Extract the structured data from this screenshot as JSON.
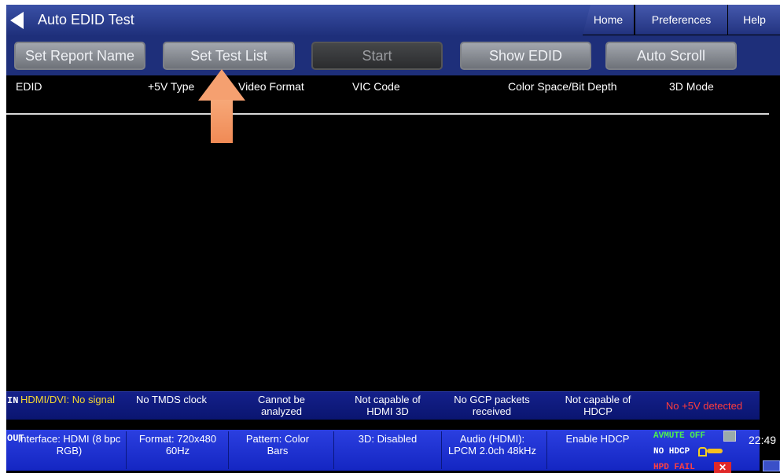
{
  "app": {
    "title": "Auto EDID Test"
  },
  "nav_tabs": {
    "home": "Home",
    "preferences": "Preferences",
    "help": "Help"
  },
  "toolbar": {
    "set_report_name": "Set Report Name",
    "set_test_list": "Set Test List",
    "start": "Start",
    "show_edid": "Show EDID",
    "auto_scroll": "Auto Scroll"
  },
  "table": {
    "columns": [
      "EDID",
      "+5V Type",
      "Video Format",
      "VIC Code",
      "Color Space/Bit Depth",
      "3D Mode"
    ],
    "rows": []
  },
  "status_in": {
    "side_label": "IN",
    "cells": [
      {
        "text": "HDMI/DVI: No signal",
        "color": "#f5d830"
      },
      {
        "text": "No TMDS clock",
        "color": "#ffffff"
      },
      {
        "text": "Cannot be analyzed",
        "color": "#ffffff"
      },
      {
        "text": "Not capable of HDMI 3D",
        "color": "#ffffff"
      },
      {
        "text": "No GCP packets received",
        "color": "#ffffff"
      },
      {
        "text": "Not capable of HDCP",
        "color": "#ffffff"
      },
      {
        "text": "No +5V detected",
        "color": "#ff3c3c"
      }
    ]
  },
  "status_out": {
    "side_label": "OUT",
    "interface": "Interface: HDMI (8 bpc RGB)",
    "format": "Format: 720x480 60Hz",
    "pattern": "Pattern: Color Bars",
    "three_d": "3D: Disabled",
    "audio": "Audio (HDMI): LPCM 2.0ch 48kHz",
    "hdcp_button": "Enable HDCP",
    "avmute": "AVMUTE OFF",
    "no_hdcp": "NO HDCP",
    "hpd_fail": "HPD FAIL",
    "time": "22:49"
  },
  "icons": {
    "back": "back-arrow-icon",
    "annotation": "arrow-up-icon",
    "lock": "lock-icon",
    "key": "key-icon",
    "monitor": "monitor-icon",
    "close": "close-icon"
  },
  "colors": {
    "accent_bar": "#1e2f7a",
    "annotation_arrow": "#f5a070",
    "status_out_bg": "#1426c2",
    "warning": "#f5d830",
    "error": "#ff3c3c"
  }
}
